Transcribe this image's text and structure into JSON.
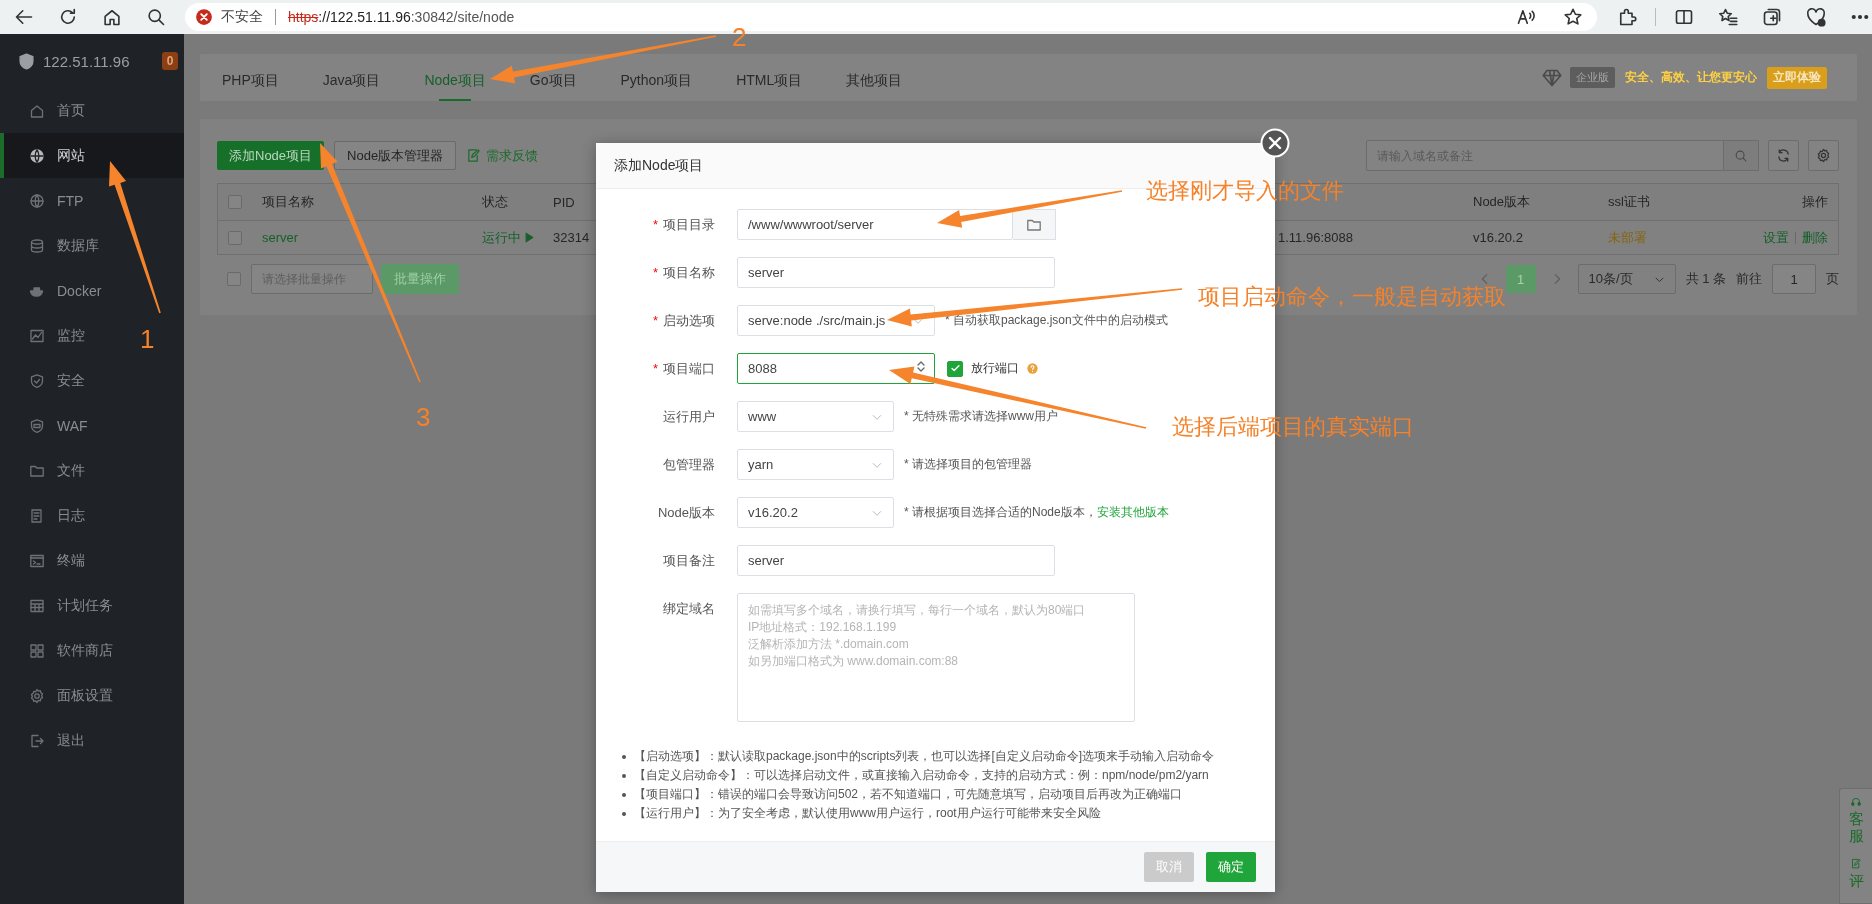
{
  "browser": {
    "security_label": "不安全",
    "secure": false,
    "url": {
      "scheme": "https",
      "address": "://122.51.11.96",
      "path": ":30842/site/node"
    }
  },
  "sidebar": {
    "server": "122.51.11.96",
    "badge": "0",
    "items": [
      {
        "label": "首页",
        "selected": false
      },
      {
        "label": "网站",
        "selected": true
      },
      {
        "label": "FTP",
        "selected": false
      },
      {
        "label": "数据库",
        "selected": false
      },
      {
        "label": "Docker",
        "selected": false
      },
      {
        "label": "监控",
        "selected": false
      },
      {
        "label": "安全",
        "selected": false
      },
      {
        "label": "WAF",
        "selected": false
      },
      {
        "label": "文件",
        "selected": false
      },
      {
        "label": "日志",
        "selected": false
      },
      {
        "label": "终端",
        "selected": false
      },
      {
        "label": "计划任务",
        "selected": false
      },
      {
        "label": "软件商店",
        "selected": false
      },
      {
        "label": "面板设置",
        "selected": false
      },
      {
        "label": "退出",
        "selected": false
      }
    ]
  },
  "tabs": [
    {
      "label": "PHP项目",
      "selected": false
    },
    {
      "label": "Java项目",
      "selected": false
    },
    {
      "label": "Node项目",
      "selected": true
    },
    {
      "label": "Go项目",
      "selected": false
    },
    {
      "label": "Python项目",
      "selected": false
    },
    {
      "label": "HTML项目",
      "selected": false
    },
    {
      "label": "其他项目",
      "selected": false
    }
  ],
  "promo": {
    "edition": "企业版",
    "slogan": "安全、高效、让您更安心",
    "button": "立即体验"
  },
  "toolbar": {
    "add_button": "添加Node项目",
    "version_button": "Node版本管理器",
    "feedback_link": "需求反馈",
    "search_placeholder": "请输入域名或备注"
  },
  "table": {
    "select_all_checked": false,
    "columns": [
      "项目名称",
      "状态",
      "PID",
      "Node版本",
      "ssl证书",
      "操作"
    ],
    "rows": [
      {
        "checked": false,
        "name": "server",
        "status": "运行中",
        "running": true,
        "pid": "32314",
        "address": "1.11.96:8088",
        "node_version": "v16.20.2",
        "ssl": "未部署",
        "actions": [
          "设置",
          "删除"
        ]
      }
    ]
  },
  "batch": {
    "checked": false,
    "placeholder": "请选择批量操作",
    "button": "批量操作"
  },
  "pagination": {
    "pages": [
      {
        "label": "1",
        "selected": true
      }
    ],
    "page_size": "10条/页",
    "total": "共 1 条",
    "goto_label": "前往",
    "goto_value": "1",
    "page_suffix": "页"
  },
  "modal": {
    "title": "添加Node项目",
    "required_mark": "*",
    "fields": [
      {
        "kind": "path",
        "label": "项目目录",
        "required": true,
        "focused": false,
        "value": "/www/wwwroot/server"
      },
      {
        "kind": "text",
        "label": "项目名称",
        "required": true,
        "focused": false,
        "value": "server"
      },
      {
        "kind": "command",
        "label": "启动选项",
        "required": true,
        "focused": false,
        "value": "serve:node ./src/main.js",
        "hint": "* 自动获取package.json文件中的启动模式"
      },
      {
        "kind": "port",
        "label": "项目端口",
        "required": true,
        "focused": true,
        "value": "8088",
        "option": {
          "label": "放行端口",
          "checked": true
        }
      },
      {
        "kind": "select",
        "label": "运行用户",
        "required": false,
        "focused": false,
        "value": "www",
        "hint": "* 无特殊需求请选择www用户"
      },
      {
        "kind": "select",
        "label": "包管理器",
        "required": false,
        "focused": false,
        "value": "yarn",
        "hint": "* 请选择项目的包管理器"
      },
      {
        "kind": "select",
        "label": "Node版本",
        "required": false,
        "focused": false,
        "value": "v16.20.2",
        "hint": "* 请根据项目选择合适的Node版本，",
        "link": "安装其他版本"
      },
      {
        "kind": "text",
        "label": "项目备注",
        "required": false,
        "focused": false,
        "value": "server"
      },
      {
        "kind": "textarea",
        "label": "绑定域名",
        "required": false,
        "focused": false,
        "placeholder": "如需填写多个域名，请换行填写，每行一个域名，默认为80端口\nIP地址格式：192.168.1.199\n泛解析添加方法 *.domain.com\n如另加端口格式为 www.domain.com:88"
      }
    ],
    "notes": [
      "【启动选项】：默认读取package.json中的scripts列表，也可以选择[自定义启动命令]选项来手动输入启动命令",
      "【自定义启动命令】：可以选择启动文件，或直接输入启动命令，支持的启动方式：例：npm/node/pm2/yarn",
      "【项目端口】：错误的端口会导致访问502，若不知道端口，可先随意填写，启动项目后再改为正确端口",
      "【运行用户】：为了安全考虑，默认使用www用户运行，root用户运行可能带来安全风险"
    ],
    "buttons": [
      {
        "kind": "cancel",
        "label": "取消"
      },
      {
        "kind": "confirm",
        "label": "确定"
      }
    ]
  },
  "float": [
    "客服",
    "评"
  ],
  "annotations": [
    {
      "label": "1"
    },
    {
      "label": "2"
    },
    {
      "label": "3"
    },
    {
      "label": "选择刚才导入的文件"
    },
    {
      "label": "项目启动命令，一般是自动获取"
    },
    {
      "label": "选择后端项目的真实端口"
    }
  ]
}
